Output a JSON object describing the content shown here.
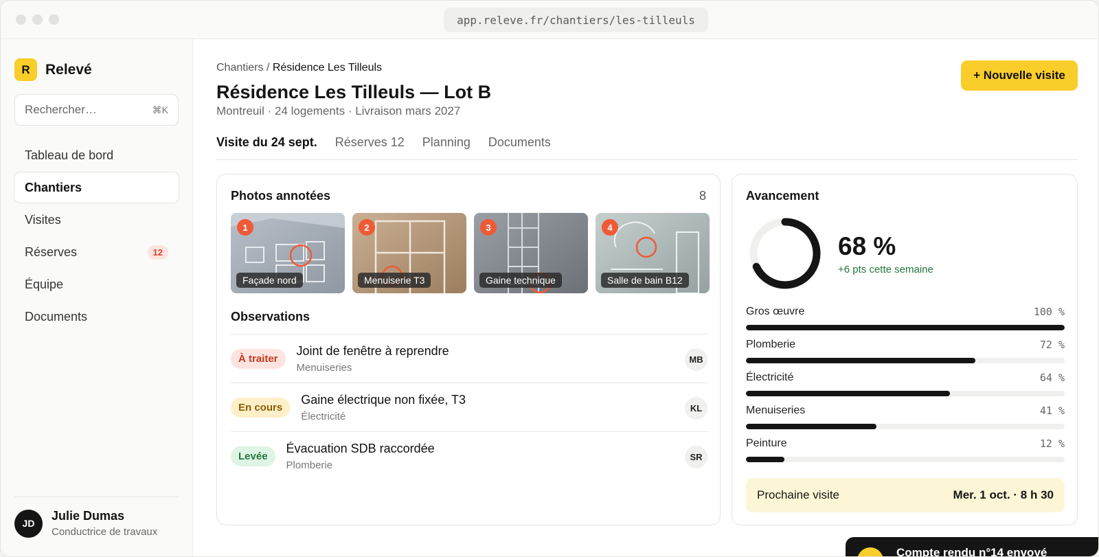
{
  "browser": {
    "url": "app.releve.fr/chantiers/les-tilleuls"
  },
  "brand": {
    "mark": "R",
    "name": "Relevé",
    "color": "#f9cd2a"
  },
  "search": {
    "placeholder": "Rechercher…",
    "shortcut": "⌘K"
  },
  "sidebar": {
    "items": [
      {
        "label": "Tableau de bord"
      },
      {
        "label": "Chantiers",
        "active": true
      },
      {
        "label": "Visites"
      },
      {
        "label": "Réserves",
        "count": "12"
      },
      {
        "label": "Équipe"
      },
      {
        "label": "Documents"
      }
    ]
  },
  "user": {
    "initials": "JD",
    "name": "Julie Dumas",
    "role": "Conductrice de travaux"
  },
  "header": {
    "breadcrumb_root": "Chantiers",
    "breadcrumb_sep": "/",
    "breadcrumb_current": "Résidence Les Tilleuls",
    "title": "Résidence Les Tilleuls — Lot B",
    "subtitle": "Montreuil · 24 logements · Livraison mars 2027",
    "new_visit_label": "+ Nouvelle visite"
  },
  "tabs": [
    {
      "label": "Visite du 24 sept.",
      "active": true
    },
    {
      "label": "Réserves 12"
    },
    {
      "label": "Planning"
    },
    {
      "label": "Documents"
    }
  ],
  "photos": {
    "title": "Photos annotées",
    "count": "8",
    "items": [
      {
        "number": "1",
        "label": "Façade nord"
      },
      {
        "number": "2",
        "label": "Menuiserie T3"
      },
      {
        "number": "3",
        "label": "Gaine technique"
      },
      {
        "number": "4",
        "label": "Salle de bain B12"
      }
    ]
  },
  "observations": {
    "title": "Observations",
    "items": [
      {
        "status": "À traiter",
        "tone": "red",
        "title": "Joint de fenêtre à reprendre",
        "category": "Menuiseries",
        "assignee": "MB"
      },
      {
        "status": "En cours",
        "tone": "yellow",
        "title": "Gaine électrique non fixée, T3",
        "category": "Électricité",
        "assignee": "KL"
      },
      {
        "status": "Levée",
        "tone": "green",
        "title": "Évacuation SDB raccordée",
        "category": "Plomberie",
        "assignee": "SR"
      }
    ]
  },
  "progress": {
    "title": "Avancement",
    "overall_value": 68,
    "overall_label": "68 %",
    "delta": "+6 pts cette semaine",
    "trades": [
      {
        "name": "Gros œuvre",
        "value": 100,
        "label": "100 %"
      },
      {
        "name": "Plomberie",
        "value": 72,
        "label": "72 %"
      },
      {
        "name": "Électricité",
        "value": 64,
        "label": "64 %"
      },
      {
        "name": "Menuiseries",
        "value": 41,
        "label": "41 %"
      },
      {
        "name": "Peinture",
        "value": 12,
        "label": "12 %"
      }
    ],
    "next_visit_label": "Prochaine visite",
    "next_visit_date": "Mer. 1 oct. · 8 h 30"
  },
  "toast": {
    "text": "Compte rendu n°14 envoyé"
  },
  "colors": {
    "accent": "#f9cd2a",
    "marker": "#ef5a36",
    "ink": "#151515",
    "success": "#23773d"
  }
}
